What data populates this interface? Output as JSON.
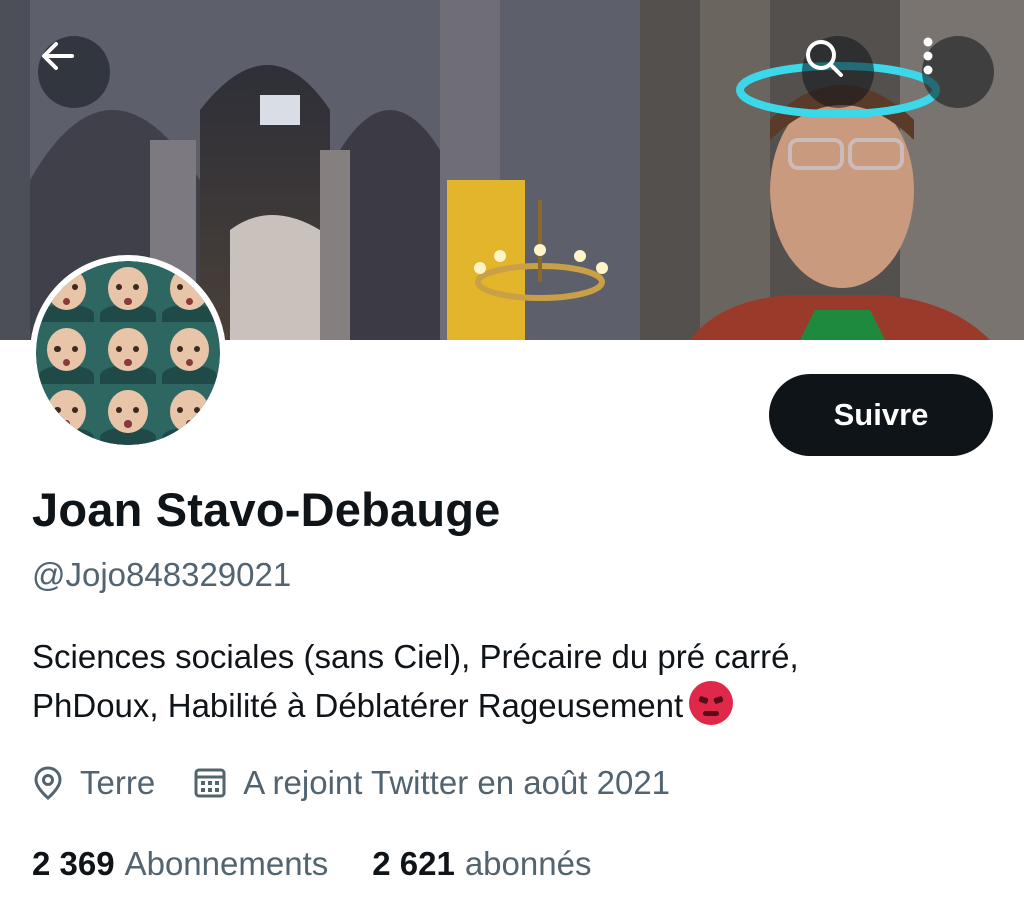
{
  "profile": {
    "display_name": "Joan Stavo-Debauge",
    "handle": "@Jojo848329021",
    "bio_line1": "Sciences sociales (sans Ciel), Précaire du pré carré,",
    "bio_line2": "PhDoux, Habilité à Déblatérer Rageusement",
    "bio_emoji": "angry-face-emoji",
    "location": "Terre",
    "joined": "A rejoint Twitter en août 2021",
    "following_count": "2 369",
    "following_label": "Abonnements",
    "followers_count": "2 621",
    "followers_label": "abonnés"
  },
  "actions": {
    "follow_label": "Suivre",
    "back_icon": "arrow-left-icon",
    "search_icon": "search-icon",
    "more_icon": "more-vertical-icon"
  },
  "icons": {
    "location": "location-pin-icon",
    "calendar": "calendar-icon"
  },
  "colors": {
    "text_primary": "#0f1419",
    "text_secondary": "#536471",
    "button_bg": "#0f1419",
    "button_text": "#ffffff"
  }
}
